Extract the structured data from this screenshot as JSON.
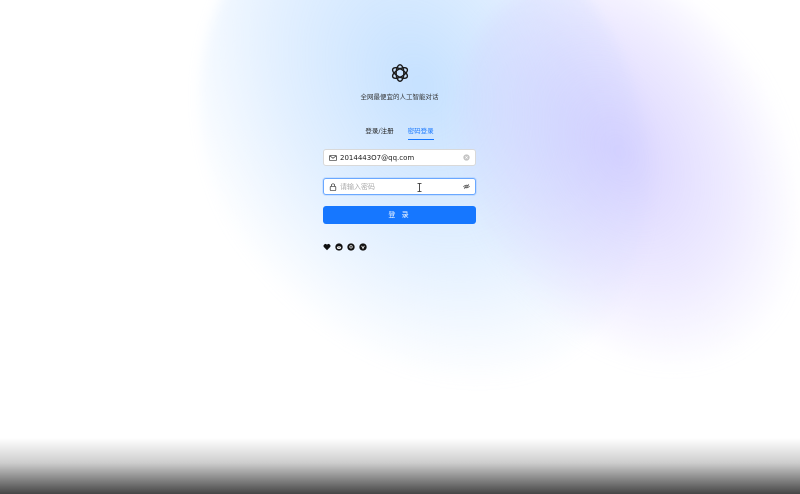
{
  "app": {
    "tagline": "全网最便宜的人工智能对话"
  },
  "tabs": [
    {
      "label": "登录/注册",
      "active": false
    },
    {
      "label": "密码登录",
      "active": true
    }
  ],
  "form": {
    "email_value": "2014443O7@qq.com",
    "password_placeholder": "请输入密码",
    "login_label": "登 录"
  },
  "icons": {
    "logo": "openai-logo",
    "email": "mail-icon",
    "clear": "clear-icon",
    "lock": "lock-icon",
    "toggle_visibility": "eye-off-icon",
    "socials": [
      "heart-icon",
      "reddit-icon",
      "github-icon",
      "shield-icon"
    ]
  },
  "colors": {
    "accent": "#1677ff"
  }
}
